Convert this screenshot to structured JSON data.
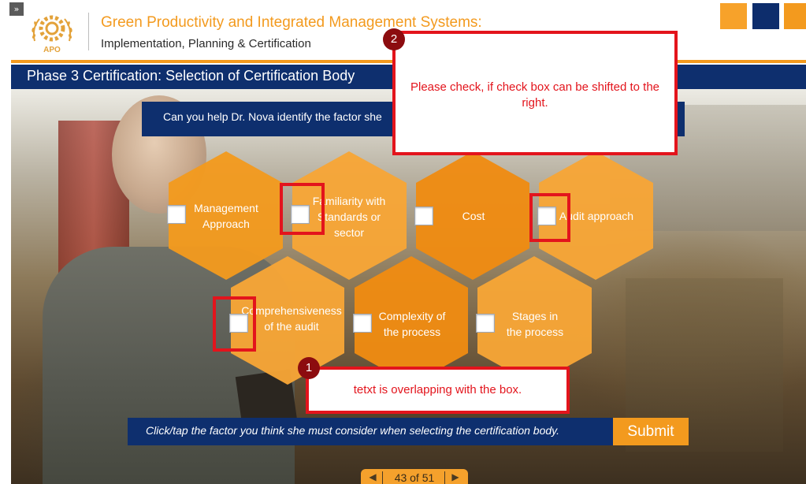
{
  "header": {
    "toggle_label": "»",
    "logo_text": "APO",
    "title": "Green Productivity and Integrated Management Systems:",
    "subtitle": "Implementation, Planning & Certification",
    "swatch_colors": [
      "#f7a22a",
      "#0d2d6c",
      "#f39a1e"
    ]
  },
  "phase": {
    "title": "Phase 3 Certification: Selection of Certification Body"
  },
  "question": {
    "text": "Can you help Dr. Nova identify the factor she"
  },
  "factors": [
    {
      "label_line1": "Management",
      "label_line2": "Approach",
      "label_line3": "",
      "color": "#f39a1e"
    },
    {
      "label_line1": "Familiarity with",
      "label_line2": "Standards or",
      "label_line3": "sector",
      "color": "#f7a536"
    },
    {
      "label_line1": "Cost",
      "label_line2": "",
      "label_line3": "",
      "color": "#ef8b12"
    },
    {
      "label_line1": "Audit approach",
      "label_line2": "",
      "label_line3": "",
      "color": "#f7a536"
    },
    {
      "label_line1": "Comprehensiveness",
      "label_line2": "of the audit",
      "label_line3": "",
      "color": "#f7a536"
    },
    {
      "label_line1": "Complexity of",
      "label_line2": "the process",
      "label_line3": "",
      "color": "#ef8b12"
    },
    {
      "label_line1": "Stages in",
      "label_line2": "the process",
      "label_line3": "",
      "color": "#f7a536"
    }
  ],
  "callouts": [
    {
      "number": "1",
      "text": "tetxt is overlapping with the box."
    },
    {
      "number": "2",
      "text": "Please check, if check box can be shifted to the right."
    }
  ],
  "instruction": {
    "text": "Click/tap the factor you think she must consider when selecting the certification body.",
    "submit_label": "Submit"
  },
  "pager": {
    "text": "43 of 51",
    "prev_icon": "chevron-left-icon",
    "next_icon": "chevron-right-icon"
  },
  "colors": {
    "navy": "#0e2f6e",
    "orange": "#f39a1e",
    "annotation_red": "#e3141c"
  }
}
